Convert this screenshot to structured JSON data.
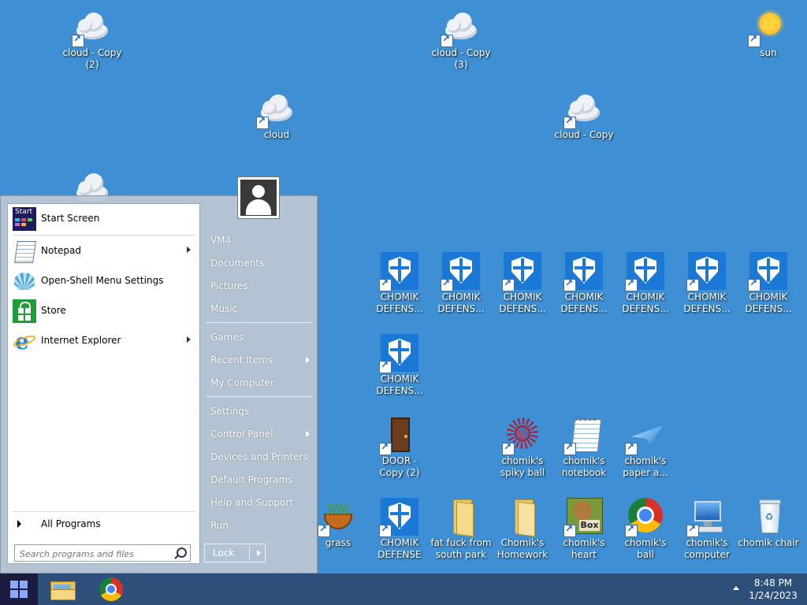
{
  "desktop": {
    "icons": {
      "cloud_copy2": {
        "label": "cloud - Copy (2)"
      },
      "cloud_copy3": {
        "label": "cloud - Copy (3)"
      },
      "sun": {
        "label": "sun"
      },
      "cloud": {
        "label": "cloud"
      },
      "cloud_copy": {
        "label": "cloud - Copy"
      },
      "defense1": {
        "label": "CHOMIK DEFENS..."
      },
      "defense2": {
        "label": "CHOMIK DEFENS..."
      },
      "defense3": {
        "label": "CHOMIK DEFENS..."
      },
      "defense4": {
        "label": "CHOMIK DEFENS..."
      },
      "defense5": {
        "label": "CHOMIK DEFENS..."
      },
      "defense6": {
        "label": "CHOMIK DEFENS..."
      },
      "defense7": {
        "label": "CHOMIK DEFENS..."
      },
      "defense8": {
        "label": "CHOMIK DEFENS..."
      },
      "door": {
        "label": "DOOR - Copy (2)"
      },
      "spiky": {
        "label": "chomik's spiky ball"
      },
      "notebook": {
        "label": "chomik's notebook"
      },
      "paper": {
        "label": "chomik's paper a..."
      },
      "grass": {
        "label": "grass"
      },
      "defense_full": {
        "label": "CHOMIK DEFENSE"
      },
      "fatfuck": {
        "label": "fat fuck from south park"
      },
      "homework": {
        "label": "Chomik's Homework"
      },
      "heart": {
        "label": "chomik's heart"
      },
      "ball": {
        "label": "chomik's ball"
      },
      "computer": {
        "label": "chomik's computer"
      },
      "chair": {
        "label": "chomik chair"
      }
    }
  },
  "start_menu": {
    "pinned": {
      "start_screen": "Start Screen",
      "notepad": "Notepad",
      "openshell": "Open-Shell Menu Settings",
      "store": "Store",
      "ie": "Internet Explorer"
    },
    "start_icon_text": "Start",
    "all_programs": "All Programs",
    "search_placeholder": "Search programs and files",
    "right": {
      "vm4": "VM4",
      "documents": "Documents",
      "pictures": "Pictures",
      "music": "Music",
      "games": "Games",
      "recent": "Recent Items",
      "computer": "My Computer",
      "settings": "Settings",
      "control": "Control Panel",
      "devices": "Devices and Printers",
      "defaults": "Default Programs",
      "help": "Help and Support",
      "run": "Run..."
    },
    "lock_label": "Lock"
  },
  "taskbar": {
    "clock_time": "8:48 PM",
    "clock_date": "1/24/2023"
  }
}
